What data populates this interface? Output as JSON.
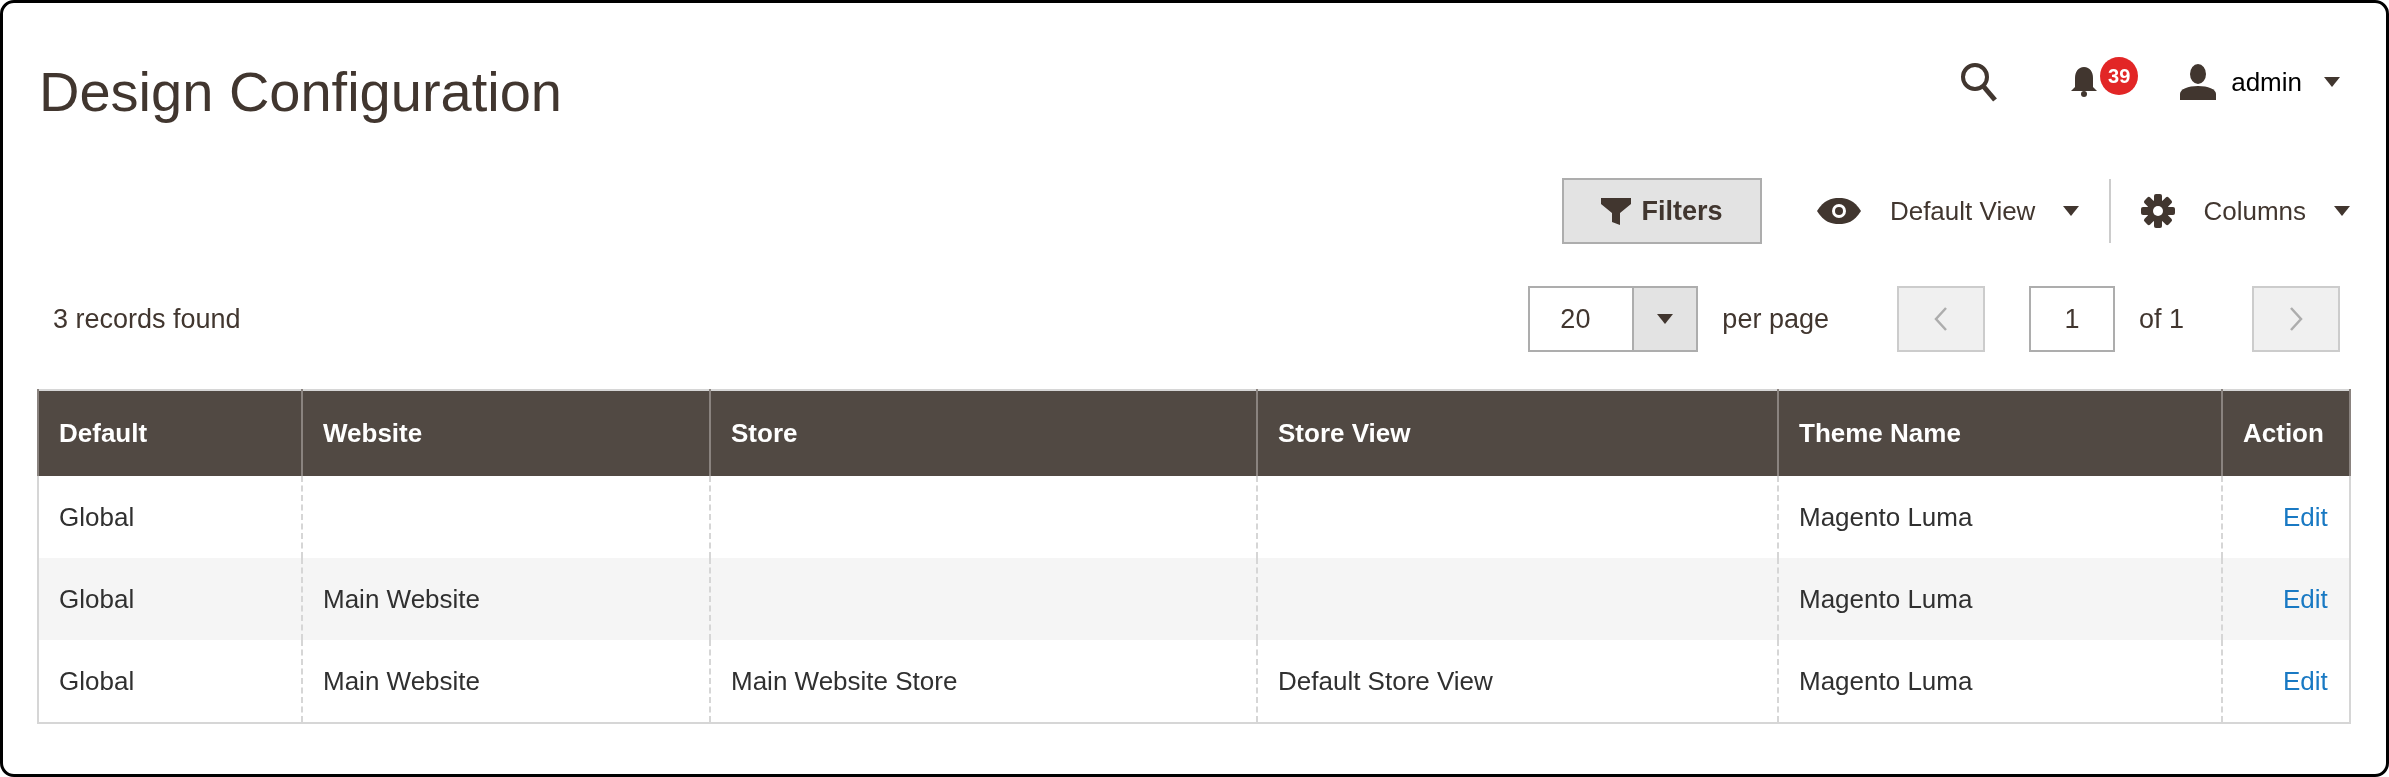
{
  "page_title": "Design Configuration",
  "header": {
    "notifications_count": "39",
    "user": "admin"
  },
  "toolbar": {
    "filters": "Filters",
    "view": "Default View",
    "columns": "Columns"
  },
  "records_found": "3 records found",
  "pagination": {
    "per_page_value": "20",
    "per_page_label": "per page",
    "page": "1",
    "page_total": "of 1",
    "prev": {
      "disabled": true
    },
    "next": {
      "disabled": true
    }
  },
  "table": {
    "columns": [
      "Default",
      "Website",
      "Store",
      "Store View",
      "Theme Name",
      "Action"
    ],
    "rows": [
      {
        "cells": [
          "Global",
          "",
          "",
          "",
          "Magento Luma"
        ],
        "action": "Edit"
      },
      {
        "cells": [
          "Global",
          "Main Website",
          "",
          "",
          "Magento Luma"
        ],
        "action": "Edit"
      },
      {
        "cells": [
          "Global",
          "Main Website",
          "Main Website Store",
          "Default Store View",
          "Magento Luma"
        ],
        "action": "Edit"
      }
    ]
  }
}
